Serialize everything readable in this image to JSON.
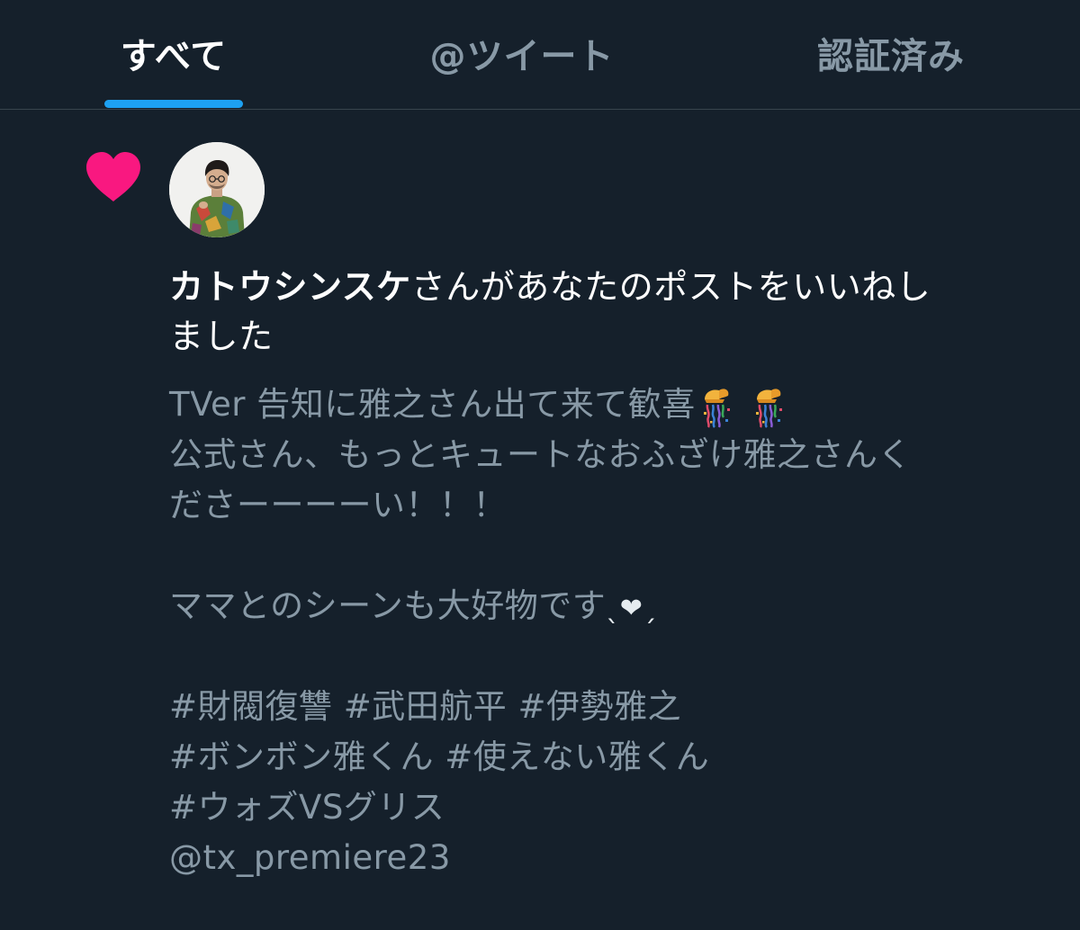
{
  "tabs": {
    "all": "すべて",
    "mentions": "@ツイート",
    "verified": "認証済み",
    "active": "all"
  },
  "notification": {
    "icon": "heart-icon",
    "user_name": "カトウシンスケ",
    "action_line1": "さんがあなたのポストをいいねし",
    "action_line2": "ました",
    "tweet": {
      "line1": "TVer 告知に雅之さん出て来て歓喜",
      "line1_emojis": [
        "confetti-ball-emoji",
        "confetti-ball-emoji"
      ],
      "line2": "公式さん、もっとキュートなおふざけ雅之さんく",
      "line3": "ださーーーーい！！！",
      "line4": "ママとのシーンも大好物です",
      "line4_suffix": "❤",
      "line5": "#財閥復讐 #武田航平 #伊勢雅之",
      "line6": "#ボンボン雅くん #使えない雅くん",
      "line7": "#ウォズVSグリス",
      "line8": "@tx_premiere23"
    }
  },
  "colors": {
    "background": "#15202b",
    "accent": "#1da1f2",
    "heart": "#f91880",
    "muted_text": "#8899a6",
    "divider": "#38444d"
  }
}
